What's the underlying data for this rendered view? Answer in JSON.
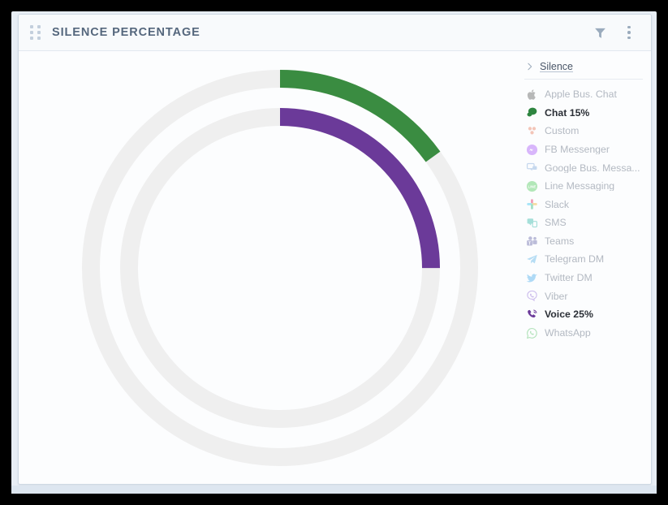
{
  "window": {
    "title": "SILENCE PERCENTAGE",
    "drag_handle": "drag-handle",
    "filter_icon": "filter-funnel-icon",
    "menu_icon": "kebab-menu-icon"
  },
  "legend": {
    "header": "Silence",
    "header_icon": "chevron-right-icon",
    "items": [
      {
        "label": "Apple Bus. Chat",
        "icon": "apple-icon",
        "color": "#5a5a5a",
        "active": false
      },
      {
        "label": "Chat 15%",
        "icon": "chat-bubble-icon",
        "color": "#2e8540",
        "active": true
      },
      {
        "label": "Custom",
        "icon": "custom-dots-icon",
        "color": "#e8795a",
        "active": false
      },
      {
        "label": "FB Messenger",
        "icon": "fb-messenger-icon",
        "color": "#a855f7",
        "active": false
      },
      {
        "label": "Google Bus. Messa...",
        "icon": "google-business-icon",
        "color": "#7da7d9",
        "active": false
      },
      {
        "label": "Line Messaging",
        "icon": "line-icon",
        "color": "#4ec95a",
        "active": false
      },
      {
        "label": "Slack",
        "icon": "slack-icon",
        "color": "#e01e5a",
        "active": false
      },
      {
        "label": "SMS",
        "icon": "sms-icon",
        "color": "#2fb6a8",
        "active": false
      },
      {
        "label": "Teams",
        "icon": "teams-icon",
        "color": "#6264a7",
        "active": false
      },
      {
        "label": "Telegram DM",
        "icon": "telegram-icon",
        "color": "#57b3e8",
        "active": false
      },
      {
        "label": "Twitter DM",
        "icon": "twitter-icon",
        "color": "#47aced",
        "active": false
      },
      {
        "label": "Viber",
        "icon": "viber-icon",
        "color": "#8a62d4",
        "active": false
      },
      {
        "label": "Voice 25%",
        "icon": "phone-icon",
        "color": "#6b3a99",
        "active": true
      },
      {
        "label": "WhatsApp",
        "icon": "whatsapp-icon",
        "color": "#4bbd5c",
        "active": false
      }
    ]
  },
  "chart_data": {
    "type": "pie",
    "variant": "concentric-radial-gauge",
    "title": "SILENCE PERCENTAGE",
    "unit": "%",
    "track_color": "#efefef",
    "start_angle_deg": 0,
    "direction": "clockwise",
    "categories": [
      "Chat",
      "Voice"
    ],
    "values": [
      15,
      25
    ],
    "series": [
      {
        "name": "Chat",
        "value": 15,
        "label": "Chat 15%",
        "color": "#3a8c41",
        "ring": "outer",
        "radius_px": 233,
        "thickness_px": 22
      },
      {
        "name": "Voice",
        "value": 25,
        "label": "Voice 25%",
        "color": "#6b3a99",
        "ring": "inner",
        "radius_px": 186,
        "thickness_px": 22
      }
    ],
    "legend_position": "right",
    "grid": false
  }
}
